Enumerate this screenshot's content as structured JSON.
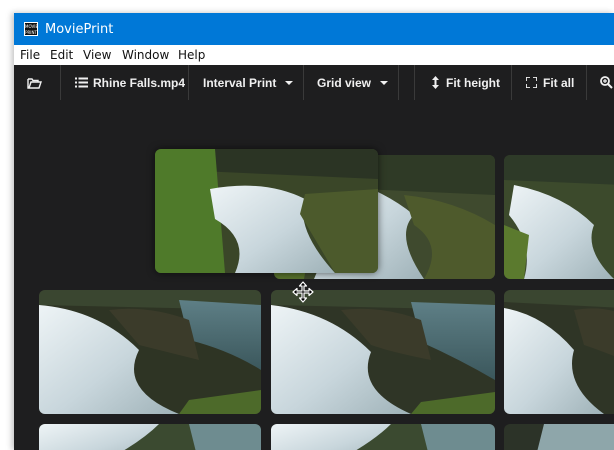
{
  "window": {
    "title": "MoviePrint",
    "app_icon_text": [
      "MOVIE",
      "PRINT"
    ]
  },
  "menu": [
    "File",
    "Edit",
    "View",
    "Window",
    "Help"
  ],
  "toolbar": {
    "open_icon": "folder-open-icon",
    "file_name": "Rhine Falls.mp4",
    "file_icon": "list-icon",
    "print_mode": "Interval Print",
    "view_mode": "Grid view",
    "fit_height": "Fit height",
    "fit_height_icon": "arrows-vertical-icon",
    "fit_all": "Fit all",
    "fit_all_icon": "expand-corners-icon",
    "zoom_icon": "zoom-icon"
  },
  "thumbnails": {
    "count_visible": 10,
    "subject": "waterfall",
    "dragging_index": 0
  },
  "colors": {
    "titlebar": "#0078d7",
    "window_bg": "#1e1e1f",
    "menubar": "#ffffff",
    "toolbar_text": "#f0f0f0"
  }
}
